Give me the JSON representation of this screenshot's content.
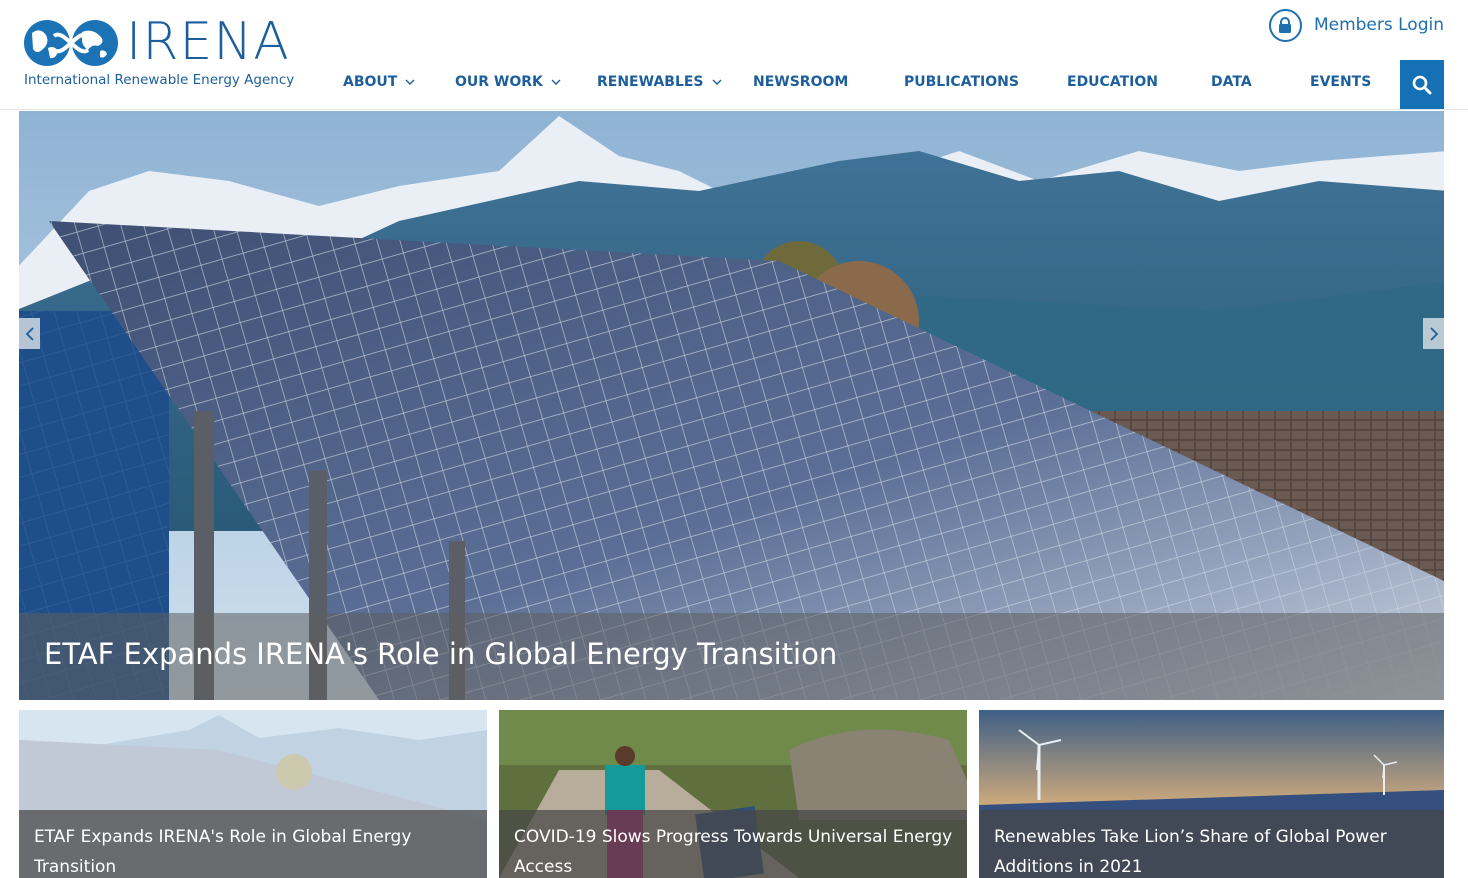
{
  "brand": {
    "name": "IRENA",
    "tagline": "International Renewable Energy Agency",
    "color": "#1d5f9c"
  },
  "members": {
    "label": "Members Login",
    "icon": "lock-icon"
  },
  "nav": {
    "items": [
      {
        "label": "ABOUT",
        "has_dropdown": true
      },
      {
        "label": "OUR WORK",
        "has_dropdown": true
      },
      {
        "label": "RENEWABLES",
        "has_dropdown": true
      },
      {
        "label": "NEWSROOM",
        "has_dropdown": false
      },
      {
        "label": "PUBLICATIONS",
        "has_dropdown": false
      },
      {
        "label": "EDUCATION",
        "has_dropdown": false
      },
      {
        "label": "DATA",
        "has_dropdown": false
      },
      {
        "label": "EVENTS",
        "has_dropdown": false
      }
    ],
    "search_icon": "search-icon",
    "accent": "#1670b5"
  },
  "hero": {
    "title": "ETAF Expands IRENA's Role in Global Energy Transition",
    "image": "solar panels in front of snowy mountains",
    "prev_icon": "chevron-left-icon",
    "next_icon": "chevron-right-icon"
  },
  "cards": [
    {
      "title": "ETAF Expands IRENA's Role in Global Energy Transition",
      "image": "solar panels and mountains"
    },
    {
      "title": "COVID-19 Slows Progress Towards Universal Energy Access",
      "image": "woman with solar panel in village"
    },
    {
      "title": "Renewables Take Lion’s Share of Global Power Additions in 2021",
      "image": "solar farm and wind turbines at sunset"
    }
  ]
}
